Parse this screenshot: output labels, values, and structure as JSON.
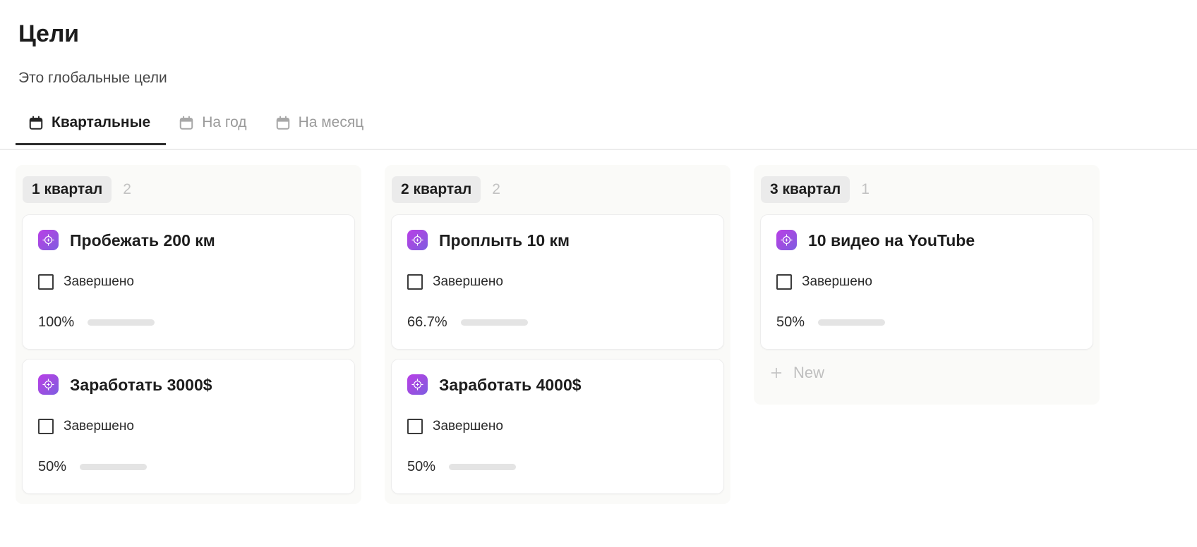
{
  "header": {
    "title": "Цели",
    "subtitle": "Это глобальные цели"
  },
  "tabs": [
    {
      "label": "Квартальные",
      "icon": "calendar-icon",
      "active": true
    },
    {
      "label": "На год",
      "icon": "calendar-icon",
      "active": false
    },
    {
      "label": "На месяц",
      "icon": "calendar-icon",
      "active": false
    }
  ],
  "colors": {
    "accent_goal_icon": "#9a4fe0",
    "progress_fill": "#7a9478",
    "progress_track": "#e4e4e4",
    "chip_background": "#ebebeb",
    "column_background": "#fafaf8",
    "active_tab_underline": "#2c2c2c"
  },
  "board": {
    "new_label": "New",
    "columns": [
      {
        "name": "1 квартал",
        "count": "2",
        "show_new": false,
        "cards": [
          {
            "icon": "target-icon",
            "title": "Пробежать 200 км",
            "checkbox_label": "Завершено",
            "checked": false,
            "percent_label": "100%",
            "percent_value": 100
          },
          {
            "icon": "target-icon",
            "title": "Заработать 3000$",
            "checkbox_label": "Завершено",
            "checked": false,
            "percent_label": "50%",
            "percent_value": 50
          }
        ]
      },
      {
        "name": "2 квартал",
        "count": "2",
        "show_new": false,
        "cards": [
          {
            "icon": "target-icon",
            "title": "Проплыть 10 км",
            "checkbox_label": "Завершено",
            "checked": false,
            "percent_label": "66.7%",
            "percent_value": 66.7
          },
          {
            "icon": "target-icon",
            "title": "Заработать 4000$",
            "checkbox_label": "Завершено",
            "checked": false,
            "percent_label": "50%",
            "percent_value": 50
          }
        ]
      },
      {
        "name": "3 квартал",
        "count": "1",
        "show_new": true,
        "cards": [
          {
            "icon": "target-icon",
            "title": "10 видео на YouTube",
            "checkbox_label": "Завершено",
            "checked": false,
            "percent_label": "50%",
            "percent_value": 50
          }
        ]
      }
    ]
  }
}
